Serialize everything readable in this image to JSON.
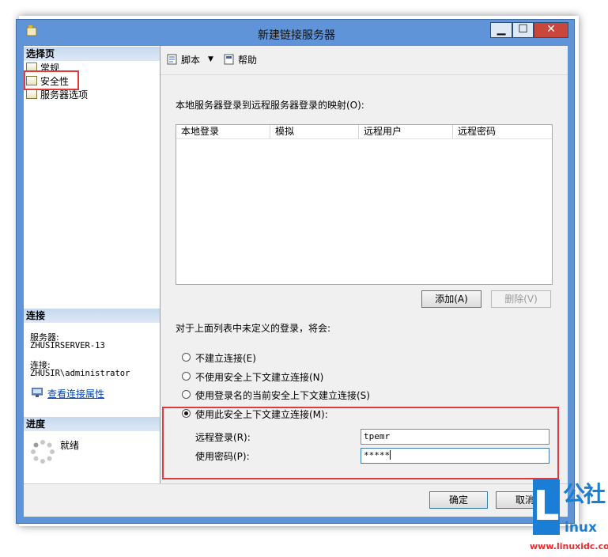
{
  "window": {
    "title": "新建链接服务器",
    "minimize": "▁",
    "maximize": "☐",
    "close": "✕"
  },
  "left": {
    "select_page_header": "选择页",
    "pages": [
      "常规",
      "安全性",
      "服务器选项"
    ],
    "connection_header": "连接",
    "server_label": "服务器:",
    "server_value": "ZHUSIRSERVER-13",
    "conn_label": "连接:",
    "conn_value": "ZHUSIR\\administrator",
    "view_conn_props": "查看连接属性",
    "progress_header": "进度",
    "progress_status": "就绪"
  },
  "toolbar": {
    "script_label": "脚本",
    "help_label": "帮助"
  },
  "main": {
    "mapping_label": "本地服务器登录到远程服务器登录的映射(O):",
    "columns": [
      "本地登录",
      "模拟",
      "远程用户",
      "远程密码"
    ],
    "add_button": "添加(A)",
    "remove_button": "删除(V)",
    "undefined_label": "对于上面列表中未定义的登录，将会:",
    "options": [
      {
        "label": "不建立连接(E)",
        "selected": false
      },
      {
        "label": "不使用安全上下文建立连接(N)",
        "selected": false
      },
      {
        "label": "使用登录名的当前安全上下文建立连接(S)",
        "selected": false
      },
      {
        "label": "使用此安全上下文建立连接(M):",
        "selected": true
      }
    ],
    "remote_login_label": "远程登录(R):",
    "remote_login_value": "tpemr",
    "password_label": "使用密码(P):",
    "password_value": "*****"
  },
  "footer": {
    "ok_button": "确定",
    "cancel_button": "取消"
  },
  "watermark": {
    "letter": "L",
    "chars": "公社",
    "sub": "inux",
    "url": "www.linuxidc.com"
  },
  "colors": {
    "frame": "#5f94d8",
    "highlight_box": "#e23a3a",
    "link": "#0645ad",
    "watermark": "#1a7fd4",
    "watermark_url": "#e03030"
  }
}
